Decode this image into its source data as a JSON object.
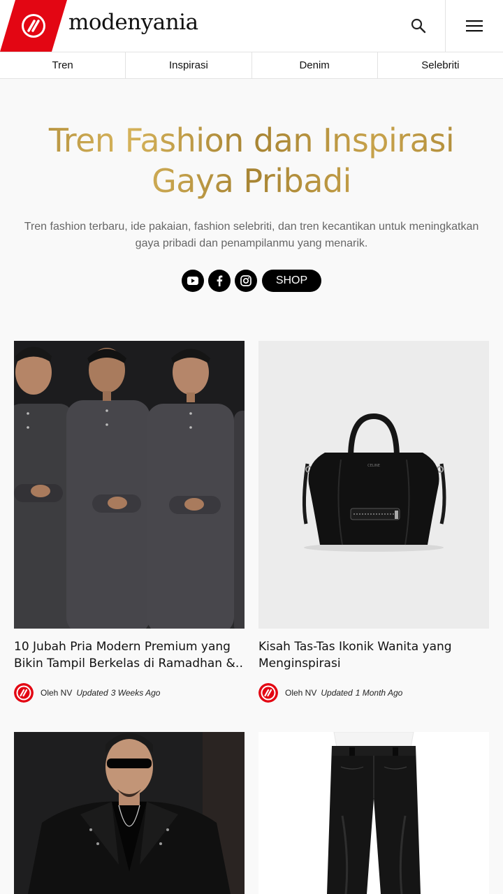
{
  "brand": {
    "name": "modenyania",
    "logo_color": "#e30613"
  },
  "nav": {
    "items": [
      "Tren",
      "Inspirasi",
      "Denim",
      "Selebriti"
    ]
  },
  "hero": {
    "title_line1": "Tren Fashion dan Inspirasi",
    "title_line2": "Gaya Pribadi",
    "description_line1": "Tren fashion terbaru, ide pakaian, fashion selebriti, dan tren kecantikan untuk meningkatkan",
    "description_line2": "gaya pribadi dan penampilanmu yang menarik.",
    "title_color": "#b8953f"
  },
  "social": {
    "icons": [
      "youtube-icon",
      "facebook-icon",
      "instagram-icon"
    ],
    "shop_label": "SHOP"
  },
  "articles": [
    {
      "title_line1": "10 Jubah Pria Modern Premium yang",
      "title_line2": "Bikin Tampil Berkelas di Ramadhan &…",
      "author": "Oleh NV",
      "updated_label": "Updated",
      "time": "3 Weeks Ago"
    },
    {
      "title_line1": "Kisah Tas-Tas Ikonik Wanita yang",
      "title_line2": "Menginspirasi",
      "author": "Oleh NV",
      "updated_label": "Updated",
      "time": "1 Month Ago"
    }
  ]
}
